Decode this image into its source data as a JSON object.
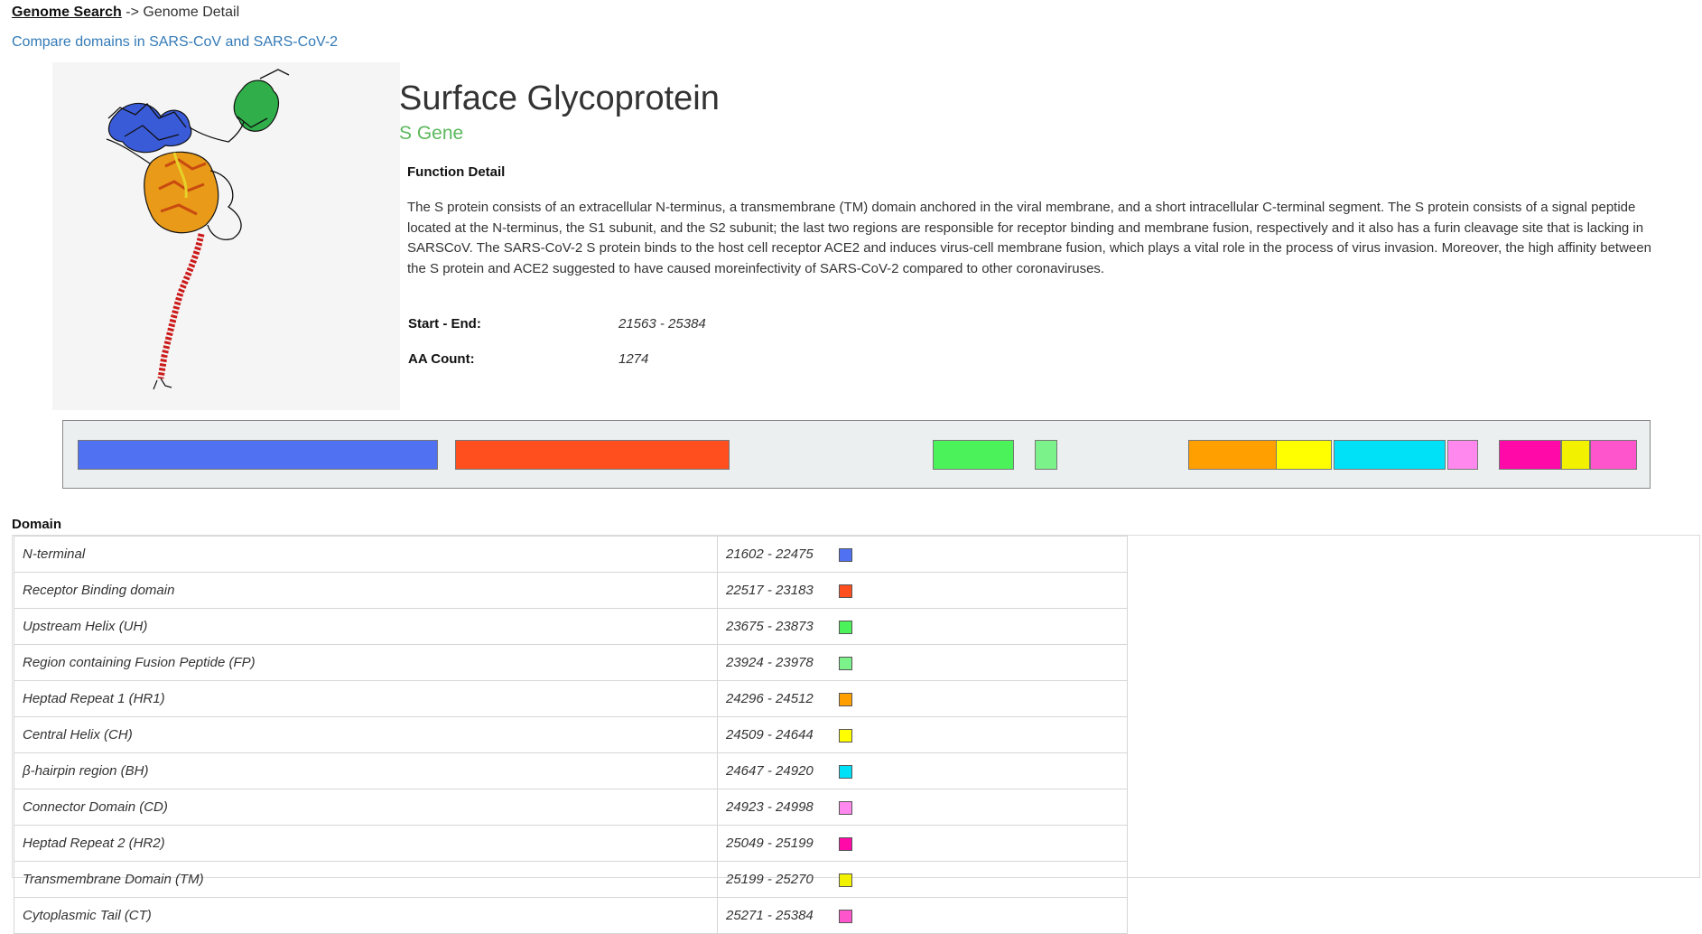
{
  "breadcrumb": {
    "home_label": "Genome Search",
    "separator": "->",
    "current": "Genome Detail"
  },
  "compare_link": "Compare domains in SARS-CoV and SARS-CoV-2",
  "protein": {
    "title": "Surface Glycoprotein",
    "gene": "S Gene",
    "function_heading": "Function Detail",
    "function_text": "The S protein consists of an extracellular N-terminus, a transmembrane (TM) domain anchored in the viral membrane, and a short intracellular C-terminal segment. The S protein consists of a signal peptide located at the N-terminus, the S1 subunit, and the S2 subunit; the last two regions are responsible for receptor binding and membrane fusion, respectively and it also has a furin cleavage site that is lacking in SARSCoV. The SARS-CoV-2 S protein binds to the host cell receptor ACE2 and induces virus-cell membrane fusion, which plays a vital role in the process of virus invasion. Moreover, the high affinity between the S protein and ACE2 suggested to have caused moreinfectivity of SARS-CoV-2 compared to other coronaviruses.",
    "start_end_label": "Start - End:",
    "start_end_value": "21563 - 25384",
    "aa_count_label": "AA Count:",
    "aa_count_value": "1274"
  },
  "domain_heading": "Domain",
  "domains": [
    {
      "name": "N-terminal",
      "range": "21602 - 22475",
      "color": "#4f71f2"
    },
    {
      "name": "Receptor Binding domain",
      "range": "22517 - 23183",
      "color": "#ff4f1f"
    },
    {
      "name": "Upstream Helix (UH)",
      "range": "23675 - 23873",
      "color": "#4cf25a"
    },
    {
      "name": "Region containing Fusion Peptide (FP)",
      "range": "23924 - 23978",
      "color": "#7cf28a"
    },
    {
      "name": "Heptad Repeat 1 (HR1)",
      "range": "24296 - 24512",
      "color": "#ff9f00"
    },
    {
      "name": "Central Helix (CH)",
      "range": "24509 - 24644",
      "color": "#ffff00"
    },
    {
      "name": "β-hairpin region (BH)",
      "range": "24647 - 24920",
      "color": "#00e1f7"
    },
    {
      "name": "Connector Domain (CD)",
      "range": "24923 - 24998",
      "color": "#ff88ee"
    },
    {
      "name": "Heptad Repeat 2 (HR2)",
      "range": "25049 - 25199",
      "color": "#ff0aa8"
    },
    {
      "name": "Transmembrane Domain (TM)",
      "range": "25199 - 25270",
      "color": "#f2f200"
    },
    {
      "name": "Cytoplasmic Tail (CT)",
      "range": "25271 - 25384",
      "color": "#ff55cc"
    }
  ]
}
